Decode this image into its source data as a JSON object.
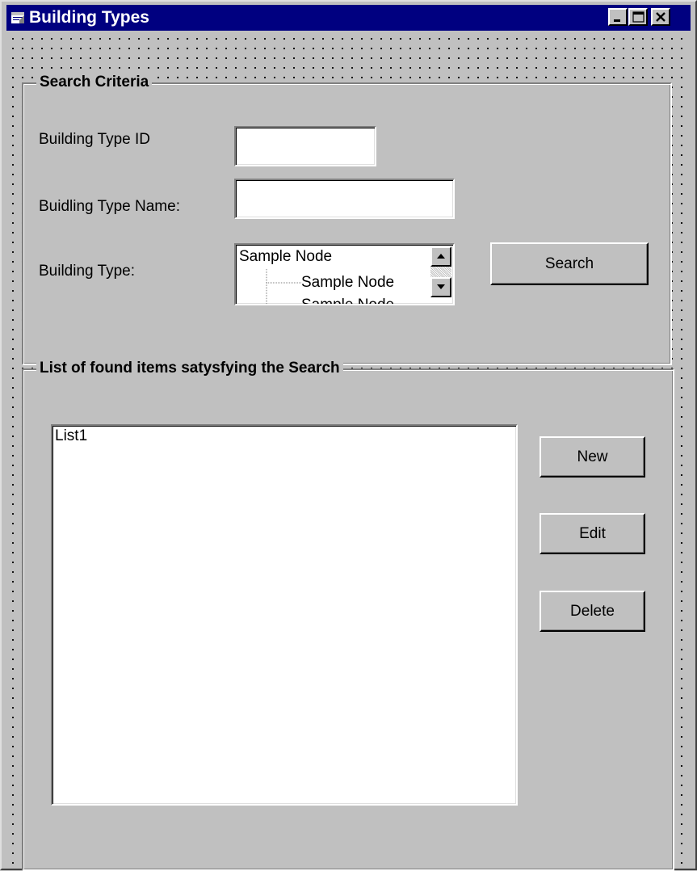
{
  "window": {
    "title": "Building Types",
    "title_icon": "form-icon",
    "caption_buttons": [
      "minimize-icon",
      "maximize-icon",
      "close-icon"
    ],
    "colors": {
      "title_bar": "#000080",
      "face": "#c0c0c0",
      "field": "#ffffff"
    }
  },
  "search_criteria": {
    "caption": "Search Criteria",
    "type_id_label": "Building Type ID",
    "type_id_value": "",
    "type_name_label": "Buidling  Type Name:",
    "type_name_value": "",
    "building_type_label": "Building Type:",
    "tree": {
      "root": "Sample Node",
      "child": "Sample Node",
      "child2": "Sample Node"
    },
    "search_button": "Search"
  },
  "results": {
    "caption": "List of found items satysfying the Search",
    "list_placeholder": "List1",
    "new_button": "New",
    "edit_button": "Edit",
    "delete_button": "Delete"
  }
}
